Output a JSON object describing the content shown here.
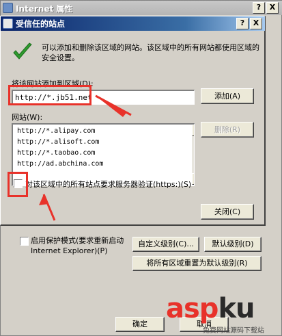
{
  "parent": {
    "title": "Internet 属性",
    "help_btn": "?",
    "close_btn": "X",
    "protect_mode_label": "启用保护模式(要求重新启动 Internet Explorer)(P)",
    "custom_level_btn": "自定义级别(C)...",
    "default_level_btn": "默认级别(D)",
    "reset_all_btn": "将所有区域重置为默认级别(R)",
    "ok_btn": "确定",
    "cancel_btn": "取消"
  },
  "dialog": {
    "title": "受信任的站点",
    "help_btn": "?",
    "close_btn": "X",
    "description": "可以添加和删除该区域的网站。该区域中的所有网站都使用区域的安全设置。",
    "add_label": "将该网站添加到区域(D):",
    "url_value": "http://*.jb51.net",
    "add_btn": "添加(A)",
    "sites_label": "网站(W):",
    "sites": [
      "http://*.alipay.com",
      "http://*.alisoft.com",
      "http://*.taobao.com",
      "http://ad.abchina.com"
    ],
    "remove_btn": "删除(R)",
    "https_label": "对该区域中的所有站点要求服务器验证(https:)(S)",
    "https_checked": false,
    "close_dialog_btn": "关闭(C)"
  },
  "icons": {
    "check": "check-mark-icon",
    "arrow": "red-arrow-icon"
  },
  "colors": {
    "annotation_red": "#e8322a",
    "title_bar_active": "#0a246a",
    "window_bg": "#d4d0c8"
  },
  "watermark": {
    "main_part1": "asp",
    "main_part2": "ku",
    "sub": "免费网站源码下载站"
  }
}
